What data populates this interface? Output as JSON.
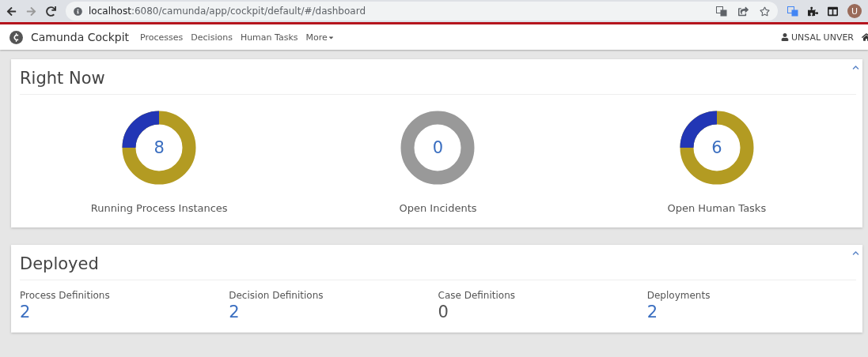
{
  "browser": {
    "url_host": "localhost",
    "url_rest": ":6080/camunda/app/cockpit/default/#/dashboard",
    "profile_initial": "U"
  },
  "navbar": {
    "brand": "Camunda Cockpit",
    "links": [
      "Processes",
      "Decisions",
      "Human Tasks"
    ],
    "more": "More",
    "user": "UNSAL UNVER"
  },
  "right_now": {
    "title": "Right Now",
    "items": [
      {
        "count": "8",
        "label": "Running Process Instances",
        "kind": "mixed"
      },
      {
        "count": "0",
        "label": "Open Incidents",
        "kind": "empty"
      },
      {
        "count": "6",
        "label": "Open Human Tasks",
        "kind": "mixed"
      }
    ]
  },
  "deployed": {
    "title": "Deployed",
    "items": [
      {
        "label": "Process Definitions",
        "count": "2",
        "kind": "link"
      },
      {
        "label": "Decision Definitions",
        "count": "2",
        "kind": "link"
      },
      {
        "label": "Case Definitions",
        "count": "0",
        "kind": "plain"
      },
      {
        "label": "Deployments",
        "count": "2",
        "kind": "link"
      }
    ]
  }
}
